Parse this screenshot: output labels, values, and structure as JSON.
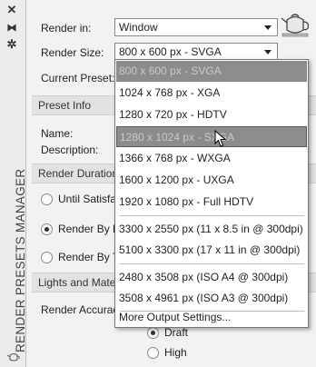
{
  "rail": {
    "close_glyph": "✕",
    "pin_glyph": "⧓",
    "settings_glyph": "✲",
    "title": "RENDER PRESETS MANAGER"
  },
  "top": {
    "render_in_label": "Render in:",
    "render_in_value": "Window",
    "render_size_label": "Render Size:",
    "render_size_value": "800 x 600 px - SVGA",
    "current_preset_label": "Current Preset:"
  },
  "preset_info": {
    "header": "Preset Info",
    "name_label": "Name:",
    "description_label": "Description:"
  },
  "render_duration": {
    "header": "Render Duration",
    "option_1": "Until Satisfa",
    "option_2": "Render By L",
    "option_3": "Render By T"
  },
  "lights": {
    "header": "Lights and Mate",
    "accuracy_label": "Render Accurac",
    "draft": "Draft",
    "high": "High"
  },
  "dropdown": {
    "options": [
      "800 x 600 px - SVGA",
      "1024 x 768 px - XGA",
      "1280 x 720 px - HDTV",
      "1280 x 1024 px - SXGA",
      "1366 x 768 px - WXGA",
      "1600 x 1200 px - UXGA",
      "1920 x 1080 px - Full HDTV",
      "3300 x 2550 px (11 x 8.5 in @ 300dpi)",
      "5100 x 3300 px (17 x 11 in @ 300dpi)",
      "2480 x 3508 px (ISO A4 @ 300dpi)",
      "3508 x 4961 px (ISO A3 @ 300dpi)",
      "More Output Settings..."
    ],
    "selected": "800 x 600 px - SVGA",
    "hovered": "1280 x 1024 px - SXGA"
  }
}
